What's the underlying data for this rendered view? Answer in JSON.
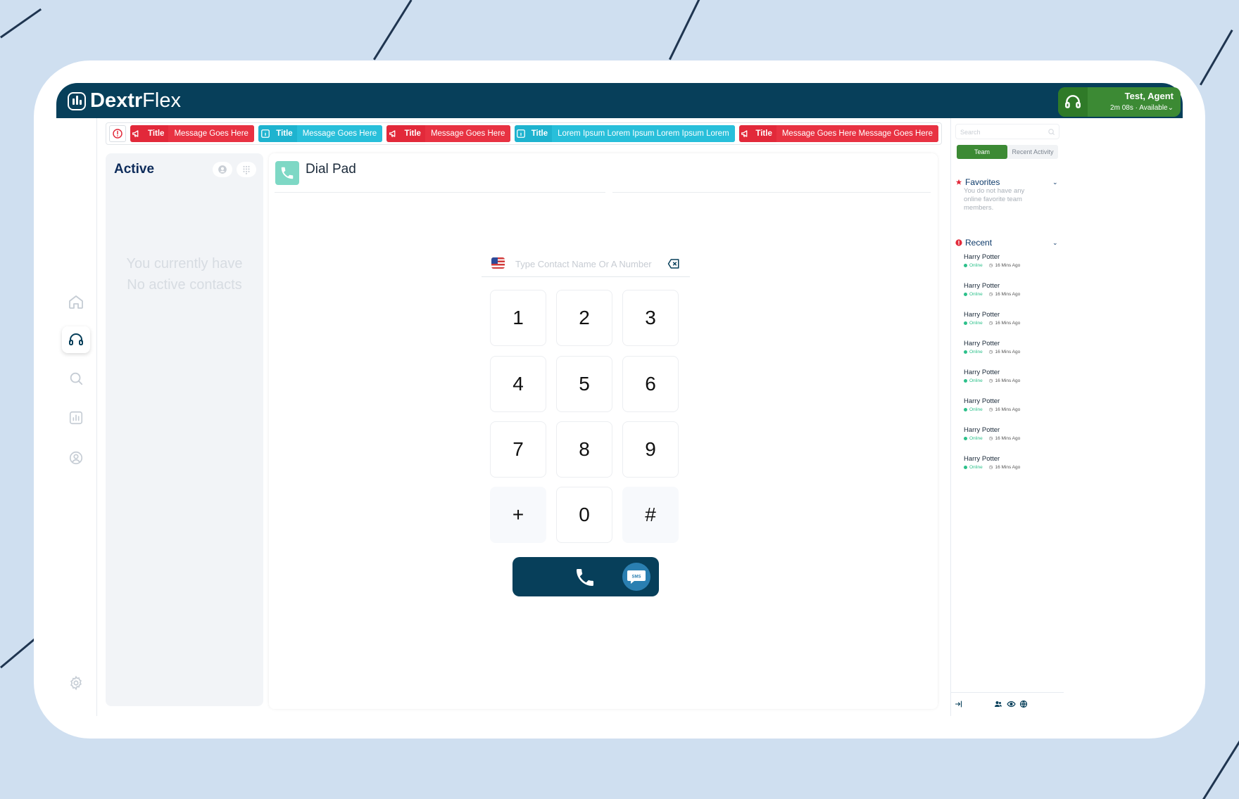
{
  "app": {
    "logo_bold": "Dextr",
    "logo_light": "Flex"
  },
  "agent": {
    "name": "Test, Agent",
    "timer": "2m 08s",
    "separator": "·",
    "status": "Available"
  },
  "alerts": [
    {
      "type": "red",
      "icon": "megaphone-icon",
      "title": "Title",
      "message": "Message Goes Here"
    },
    {
      "type": "cyan",
      "icon": "info-icon",
      "title": "Title",
      "message": "Message Goes Here"
    },
    {
      "type": "red",
      "icon": "megaphone-icon",
      "title": "Title",
      "message": "Message Goes Here"
    },
    {
      "type": "cyan",
      "icon": "info-icon",
      "title": "Title",
      "message": "Lorem Ipsum Lorem Ipsum Lorem Ipsum Lorem"
    },
    {
      "type": "red",
      "icon": "megaphone-icon",
      "title": "Title",
      "message": "Message Goes Here Message Goes Here"
    }
  ],
  "active": {
    "title": "Active",
    "empty_line1": "You currently have",
    "empty_line2": "No active contacts"
  },
  "dialpad": {
    "title": "Dial Pad",
    "input_placeholder": "Type Contact Name Or A Number",
    "input_value": "",
    "keys": [
      "1",
      "2",
      "3",
      "4",
      "5",
      "6",
      "7",
      "8",
      "9",
      "+",
      "0",
      "#"
    ],
    "sms_label": "SMS"
  },
  "team": {
    "search_placeholder": "Search",
    "tabs": [
      "Team",
      "Recent Activity"
    ],
    "favorites_title": "Favorites",
    "favorites_empty": "You do not have any online favorite team members.",
    "recent_title": "Recent",
    "recent": [
      {
        "name": "Harry Potter",
        "status": "Online",
        "time": "16 Mins Ago"
      },
      {
        "name": "Harry Potter",
        "status": "Online",
        "time": "16 Mins Ago"
      },
      {
        "name": "Harry Potter",
        "status": "Online",
        "time": "16 Mins Ago"
      },
      {
        "name": "Harry Potter",
        "status": "Online",
        "time": "16 Mins Ago"
      },
      {
        "name": "Harry Potter",
        "status": "Online",
        "time": "16 Mins Ago"
      },
      {
        "name": "Harry Potter",
        "status": "Online",
        "time": "16 Mins Ago"
      },
      {
        "name": "Harry Potter",
        "status": "Online",
        "time": "16 Mins Ago"
      },
      {
        "name": "Harry Potter",
        "status": "Online",
        "time": "16 Mins Ago"
      }
    ]
  },
  "colors": {
    "header": "#073f5a",
    "agent_green": "#3c8a34",
    "alert_red": "#e2293a",
    "alert_cyan": "#1eb3cf",
    "online": "#2cc08a"
  }
}
